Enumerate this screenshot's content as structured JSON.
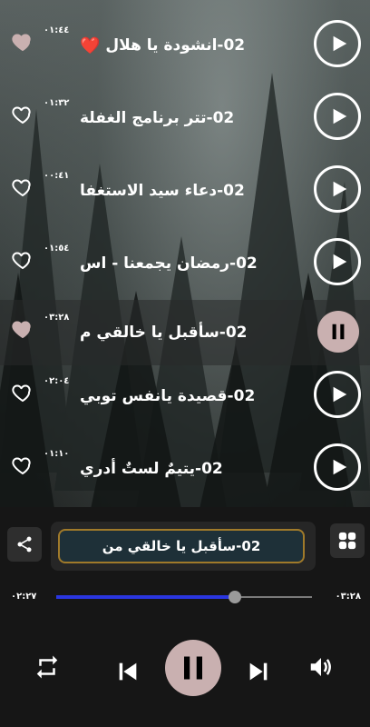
{
  "playlist": [
    {
      "title": "02-انشودة يا هلال",
      "emoji": "❤️",
      "duration": "٠١:٤٤",
      "liked": true,
      "state": "play"
    },
    {
      "title": "02-تتر برنامج الغفلة",
      "emoji": "",
      "duration": "٠١:٣٢",
      "liked": false,
      "state": "play"
    },
    {
      "title": "02-دعاء سيد الاستغفا",
      "emoji": "",
      "duration": "٠٠:٤١",
      "liked": false,
      "state": "play"
    },
    {
      "title": "02-رمضان يجمعنا - اس",
      "emoji": "",
      "duration": "٠١:٥٤",
      "liked": false,
      "state": "play"
    },
    {
      "title": "02-سأقبل يا خالقي م",
      "emoji": "",
      "duration": "٠٣:٢٨",
      "liked": true,
      "state": "pause"
    },
    {
      "title": "02-قصيدة يانفس توبي",
      "emoji": "",
      "duration": "٠٢:٠٤",
      "liked": false,
      "state": "play"
    },
    {
      "title": "02-يتيمٌ لستٌ أدري",
      "emoji": "",
      "duration": "٠١:١٠",
      "liked": false,
      "state": "play"
    }
  ],
  "player": {
    "now_playing": "02-سأقبل يا خالقي من",
    "elapsed": "٠٢:٢٧",
    "total": "٠٣:٢٨",
    "progress": 0.7
  },
  "icons": {
    "share": "share-icon",
    "grid": "grid-icon",
    "repeat": "repeat-icon",
    "previous": "skip-previous-icon",
    "pause": "pause-icon",
    "next": "skip-next-icon",
    "volume": "volume-icon"
  },
  "colors": {
    "accent": "#2a36e0",
    "pause_button": "#c9b0b0",
    "liked_heart": "#c9b0b0",
    "now_playing_border": "#a07a2a"
  }
}
